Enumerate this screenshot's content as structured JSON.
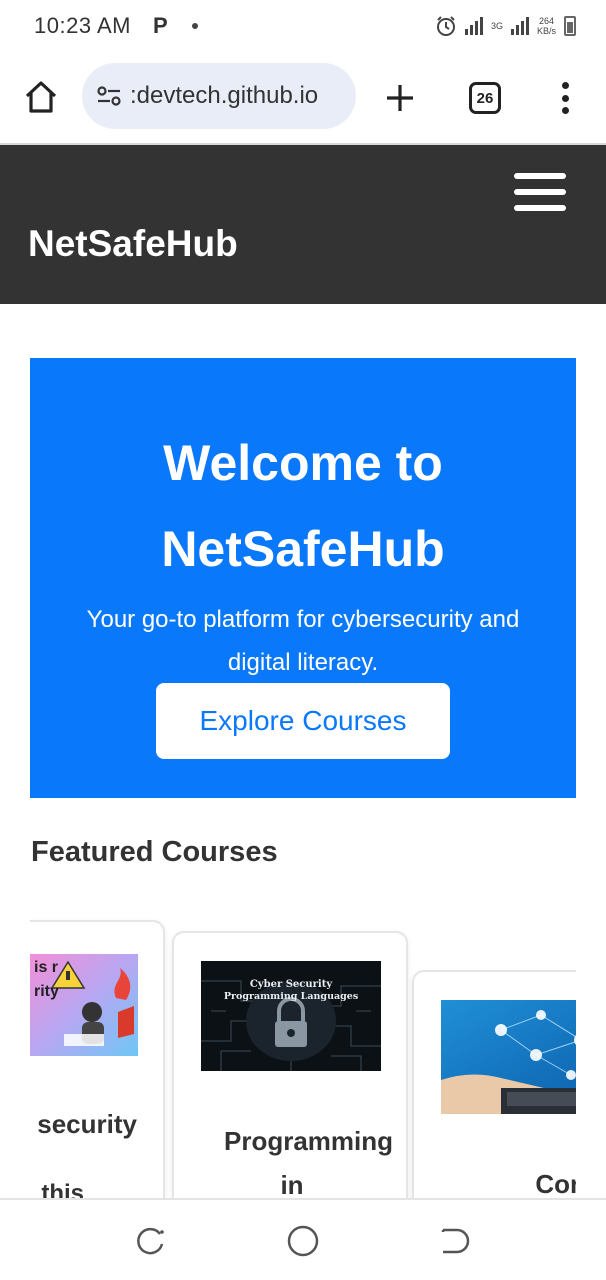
{
  "status_bar": {
    "time": "10:23 AM",
    "net_type": "3G",
    "speed_value": "264",
    "speed_unit": "KB/s"
  },
  "browser": {
    "url": ":devtech.github.io",
    "tab_count": "26"
  },
  "site": {
    "logo": "NetSafeHub"
  },
  "hero": {
    "title": "Welcome to NetSafeHub",
    "subtitle": "Your go-to platform for cybersecurity and digital literacy.",
    "cta_label": "Explore Courses",
    "background_color": "#0a78fa"
  },
  "featured": {
    "title": "Featured Courses",
    "courses": [
      {
        "title": "security",
        "desc": "this",
        "image_text": "is r rity"
      },
      {
        "title": "Programming in",
        "image_text_line1": "Cyber Security",
        "image_text_line2": "Programming Languages"
      },
      {
        "title": "Compute"
      }
    ]
  },
  "colors": {
    "header_bg": "#333333",
    "accent": "#0a78fa"
  }
}
